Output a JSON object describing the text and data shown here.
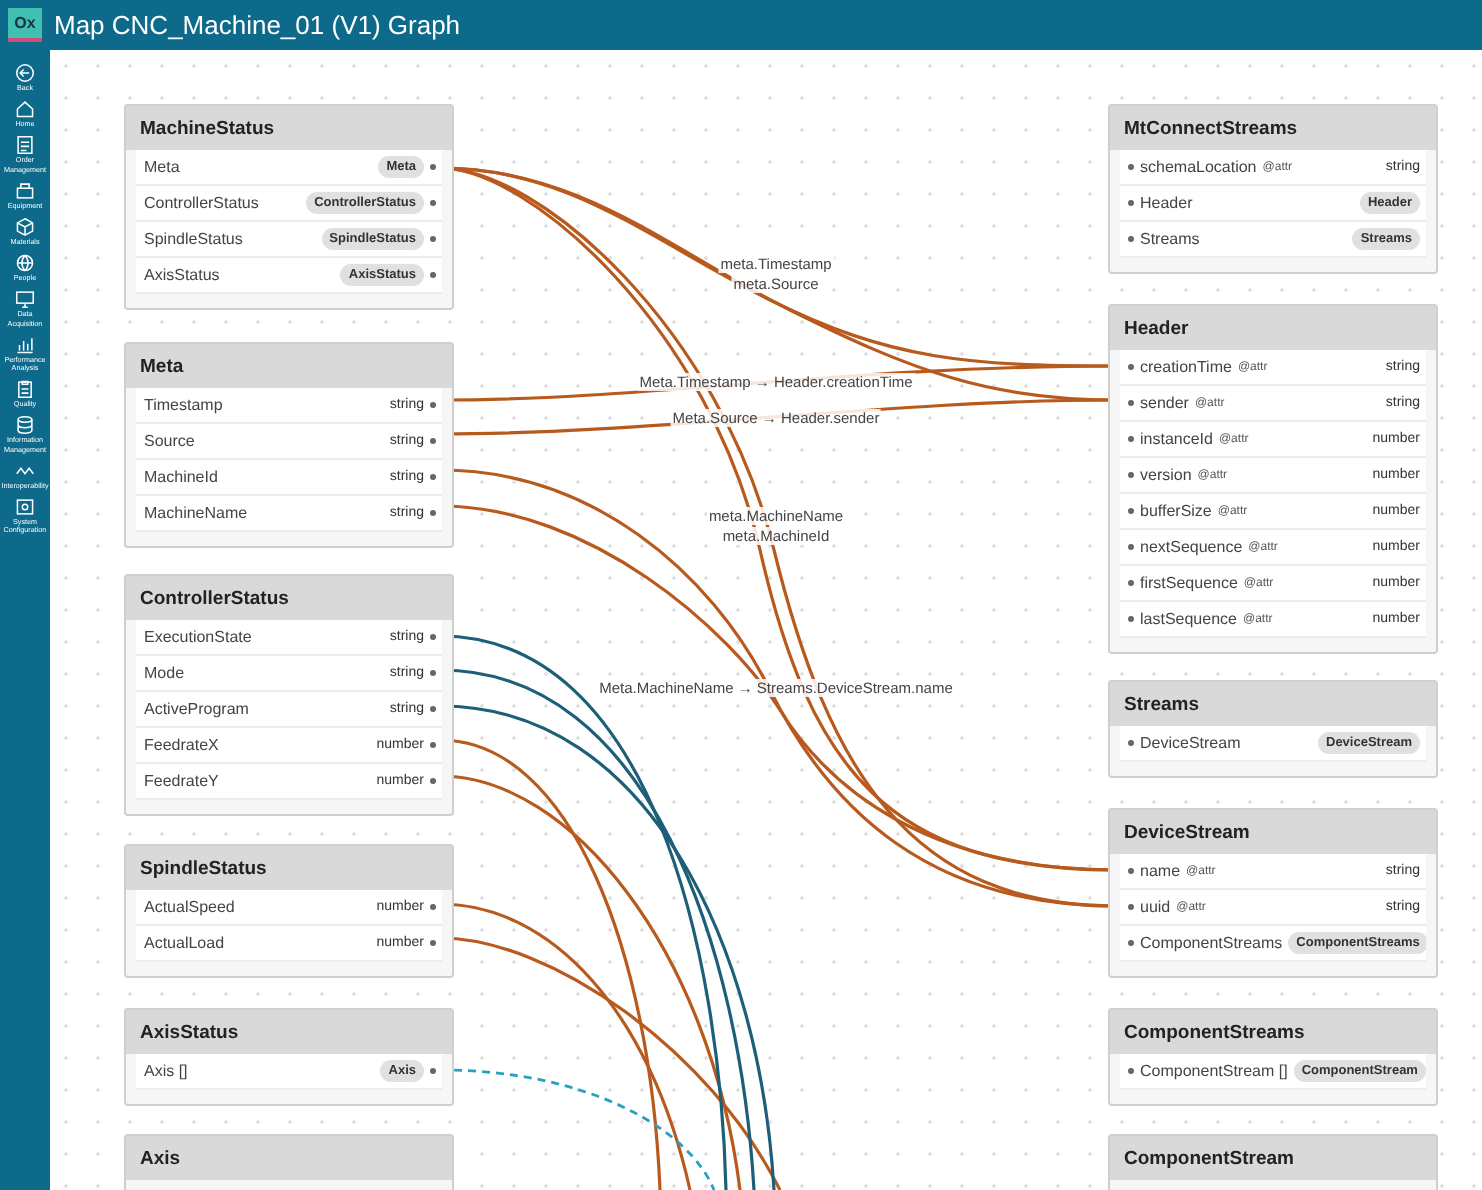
{
  "window": {
    "title": "Map CNC_Machine_01 (V1) Graph",
    "logo": "Ox"
  },
  "sidebar": {
    "items": [
      {
        "label": "Back"
      },
      {
        "label": "Home"
      },
      {
        "label": "Order Management"
      },
      {
        "label": "Equipment"
      },
      {
        "label": "Materials"
      },
      {
        "label": "People"
      },
      {
        "label": "Data Acquisition"
      },
      {
        "label": "Performance Analysis"
      },
      {
        "label": "Quality"
      },
      {
        "label": "Information Management"
      },
      {
        "label": "Interoperability"
      },
      {
        "label": "System Configuration"
      }
    ]
  },
  "left_nodes": [
    {
      "title": "MachineStatus",
      "fields": [
        {
          "name": "Meta",
          "type": "Meta",
          "kind": "ref"
        },
        {
          "name": "ControllerStatus",
          "type": "ControllerStatus",
          "kind": "ref"
        },
        {
          "name": "SpindleStatus",
          "type": "SpindleStatus",
          "kind": "ref"
        },
        {
          "name": "AxisStatus",
          "type": "AxisStatus",
          "kind": "ref"
        }
      ]
    },
    {
      "title": "Meta",
      "fields": [
        {
          "name": "Timestamp",
          "type": "string",
          "kind": "scalar"
        },
        {
          "name": "Source",
          "type": "string",
          "kind": "scalar"
        },
        {
          "name": "MachineId",
          "type": "string",
          "kind": "scalar"
        },
        {
          "name": "MachineName",
          "type": "string",
          "kind": "scalar"
        }
      ]
    },
    {
      "title": "ControllerStatus",
      "fields": [
        {
          "name": "ExecutionState",
          "type": "string",
          "kind": "scalar"
        },
        {
          "name": "Mode",
          "type": "string",
          "kind": "scalar"
        },
        {
          "name": "ActiveProgram",
          "type": "string",
          "kind": "scalar"
        },
        {
          "name": "FeedrateX",
          "type": "number",
          "kind": "scalar"
        },
        {
          "name": "FeedrateY",
          "type": "number",
          "kind": "scalar"
        }
      ]
    },
    {
      "title": "SpindleStatus",
      "fields": [
        {
          "name": "ActualSpeed",
          "type": "number",
          "kind": "scalar"
        },
        {
          "name": "ActualLoad",
          "type": "number",
          "kind": "scalar"
        }
      ]
    },
    {
      "title": "AxisStatus",
      "fields": [
        {
          "name": "Axis []",
          "type": "Axis",
          "kind": "ref"
        }
      ]
    },
    {
      "title": "Axis"
    }
  ],
  "right_nodes": [
    {
      "title": "MtConnectStreams",
      "fields": [
        {
          "name": "schemaLocation",
          "tag": "@attr",
          "type": "string",
          "kind": "scalar"
        },
        {
          "name": "Header",
          "type": "Header",
          "kind": "ref"
        },
        {
          "name": "Streams",
          "type": "Streams",
          "kind": "ref"
        }
      ]
    },
    {
      "title": "Header",
      "fields": [
        {
          "name": "creationTime",
          "tag": "@attr",
          "type": "string",
          "kind": "scalar"
        },
        {
          "name": "sender",
          "tag": "@attr",
          "type": "string",
          "kind": "scalar"
        },
        {
          "name": "instanceId",
          "tag": "@attr",
          "type": "number",
          "kind": "scalar"
        },
        {
          "name": "version",
          "tag": "@attr",
          "type": "number",
          "kind": "scalar"
        },
        {
          "name": "bufferSize",
          "tag": "@attr",
          "type": "number",
          "kind": "scalar"
        },
        {
          "name": "nextSequence",
          "tag": "@attr",
          "type": "number",
          "kind": "scalar"
        },
        {
          "name": "firstSequence",
          "tag": "@attr",
          "type": "number",
          "kind": "scalar"
        },
        {
          "name": "lastSequence",
          "tag": "@attr",
          "type": "number",
          "kind": "scalar"
        }
      ]
    },
    {
      "title": "Streams",
      "fields": [
        {
          "name": "DeviceStream",
          "type": "DeviceStream",
          "kind": "ref"
        }
      ]
    },
    {
      "title": "DeviceStream",
      "fields": [
        {
          "name": "name",
          "tag": "@attr",
          "type": "string",
          "kind": "scalar"
        },
        {
          "name": "uuid",
          "tag": "@attr",
          "type": "string",
          "kind": "scalar"
        },
        {
          "name": "ComponentStreams",
          "type": "ComponentStreams",
          "kind": "ref"
        }
      ]
    },
    {
      "title": "ComponentStreams",
      "fields": [
        {
          "name": "ComponentStream []",
          "type": "ComponentStream",
          "kind": "ref"
        }
      ]
    },
    {
      "title": "ComponentStream"
    }
  ],
  "edge_labels": [
    {
      "text": "meta.Timestamp"
    },
    {
      "text": "meta.Source"
    },
    {
      "text": "Meta.Timestamp → Header.creationTime"
    },
    {
      "text": "Meta.Source → Header.sender"
    },
    {
      "text": "meta.MachineName"
    },
    {
      "text": "meta.MachineId"
    },
    {
      "text": "Meta.MachineName → Streams.DeviceStream.name"
    }
  ]
}
